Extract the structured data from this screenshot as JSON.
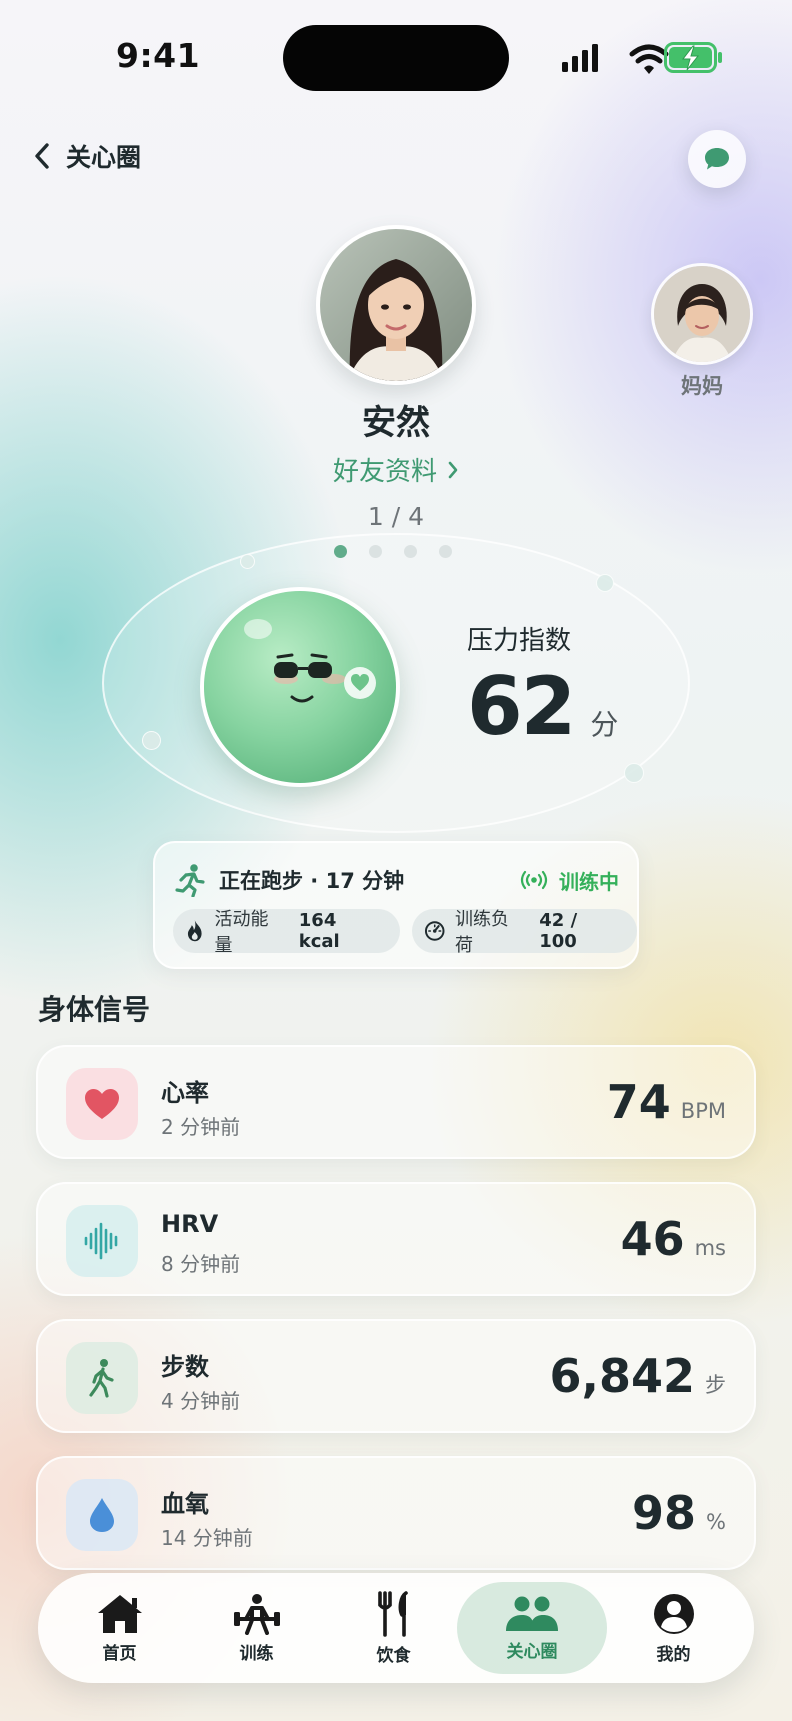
{
  "status_bar": {
    "time": "9:41"
  },
  "header": {
    "back_label": "关心圈"
  },
  "profile": {
    "name": "安然",
    "link_label": "好友资料",
    "page_counter": "1 / 4",
    "side_contact": "妈妈",
    "page_count": 4,
    "current_page": 1
  },
  "stress": {
    "label": "压力指数",
    "value": "62",
    "unit": "分"
  },
  "activity": {
    "title": "正在跑步 · 17 分钟",
    "status": "训练中",
    "chips": [
      {
        "label": "活动能量",
        "value": "164 kcal",
        "icon": "flame-icon"
      },
      {
        "label": "训练负荷",
        "value": "42 / 100",
        "icon": "gauge-icon"
      }
    ]
  },
  "signals": {
    "title": "身体信号",
    "items": [
      {
        "name": "心率",
        "time": "2 分钟前",
        "value": "74",
        "unit": "BPM",
        "icon": "heart-icon"
      },
      {
        "name": "HRV",
        "time": "8 分钟前",
        "value": "46",
        "unit": "ms",
        "icon": "waveform-icon"
      },
      {
        "name": "步数",
        "time": "4 分钟前",
        "value": "6,842",
        "unit": "步",
        "icon": "walking-icon"
      },
      {
        "name": "血氧",
        "time": "14 分钟前",
        "value": "98",
        "unit": "%",
        "icon": "droplet-icon"
      }
    ]
  },
  "nav": {
    "items": [
      {
        "label": "首页",
        "icon": "home-icon"
      },
      {
        "label": "训练",
        "icon": "weightlifting-icon"
      },
      {
        "label": "饮食",
        "icon": "utensils-icon"
      },
      {
        "label": "关心圈",
        "icon": "people-icon",
        "active": true
      },
      {
        "label": "我的",
        "icon": "user-icon"
      }
    ]
  },
  "colors": {
    "accent": "#3f9a72",
    "training_green": "#34b05a",
    "heart": "#e25563",
    "hrv": "#33a7a5",
    "steps": "#3d8a5c",
    "oxygen": "#4a8fd8"
  }
}
